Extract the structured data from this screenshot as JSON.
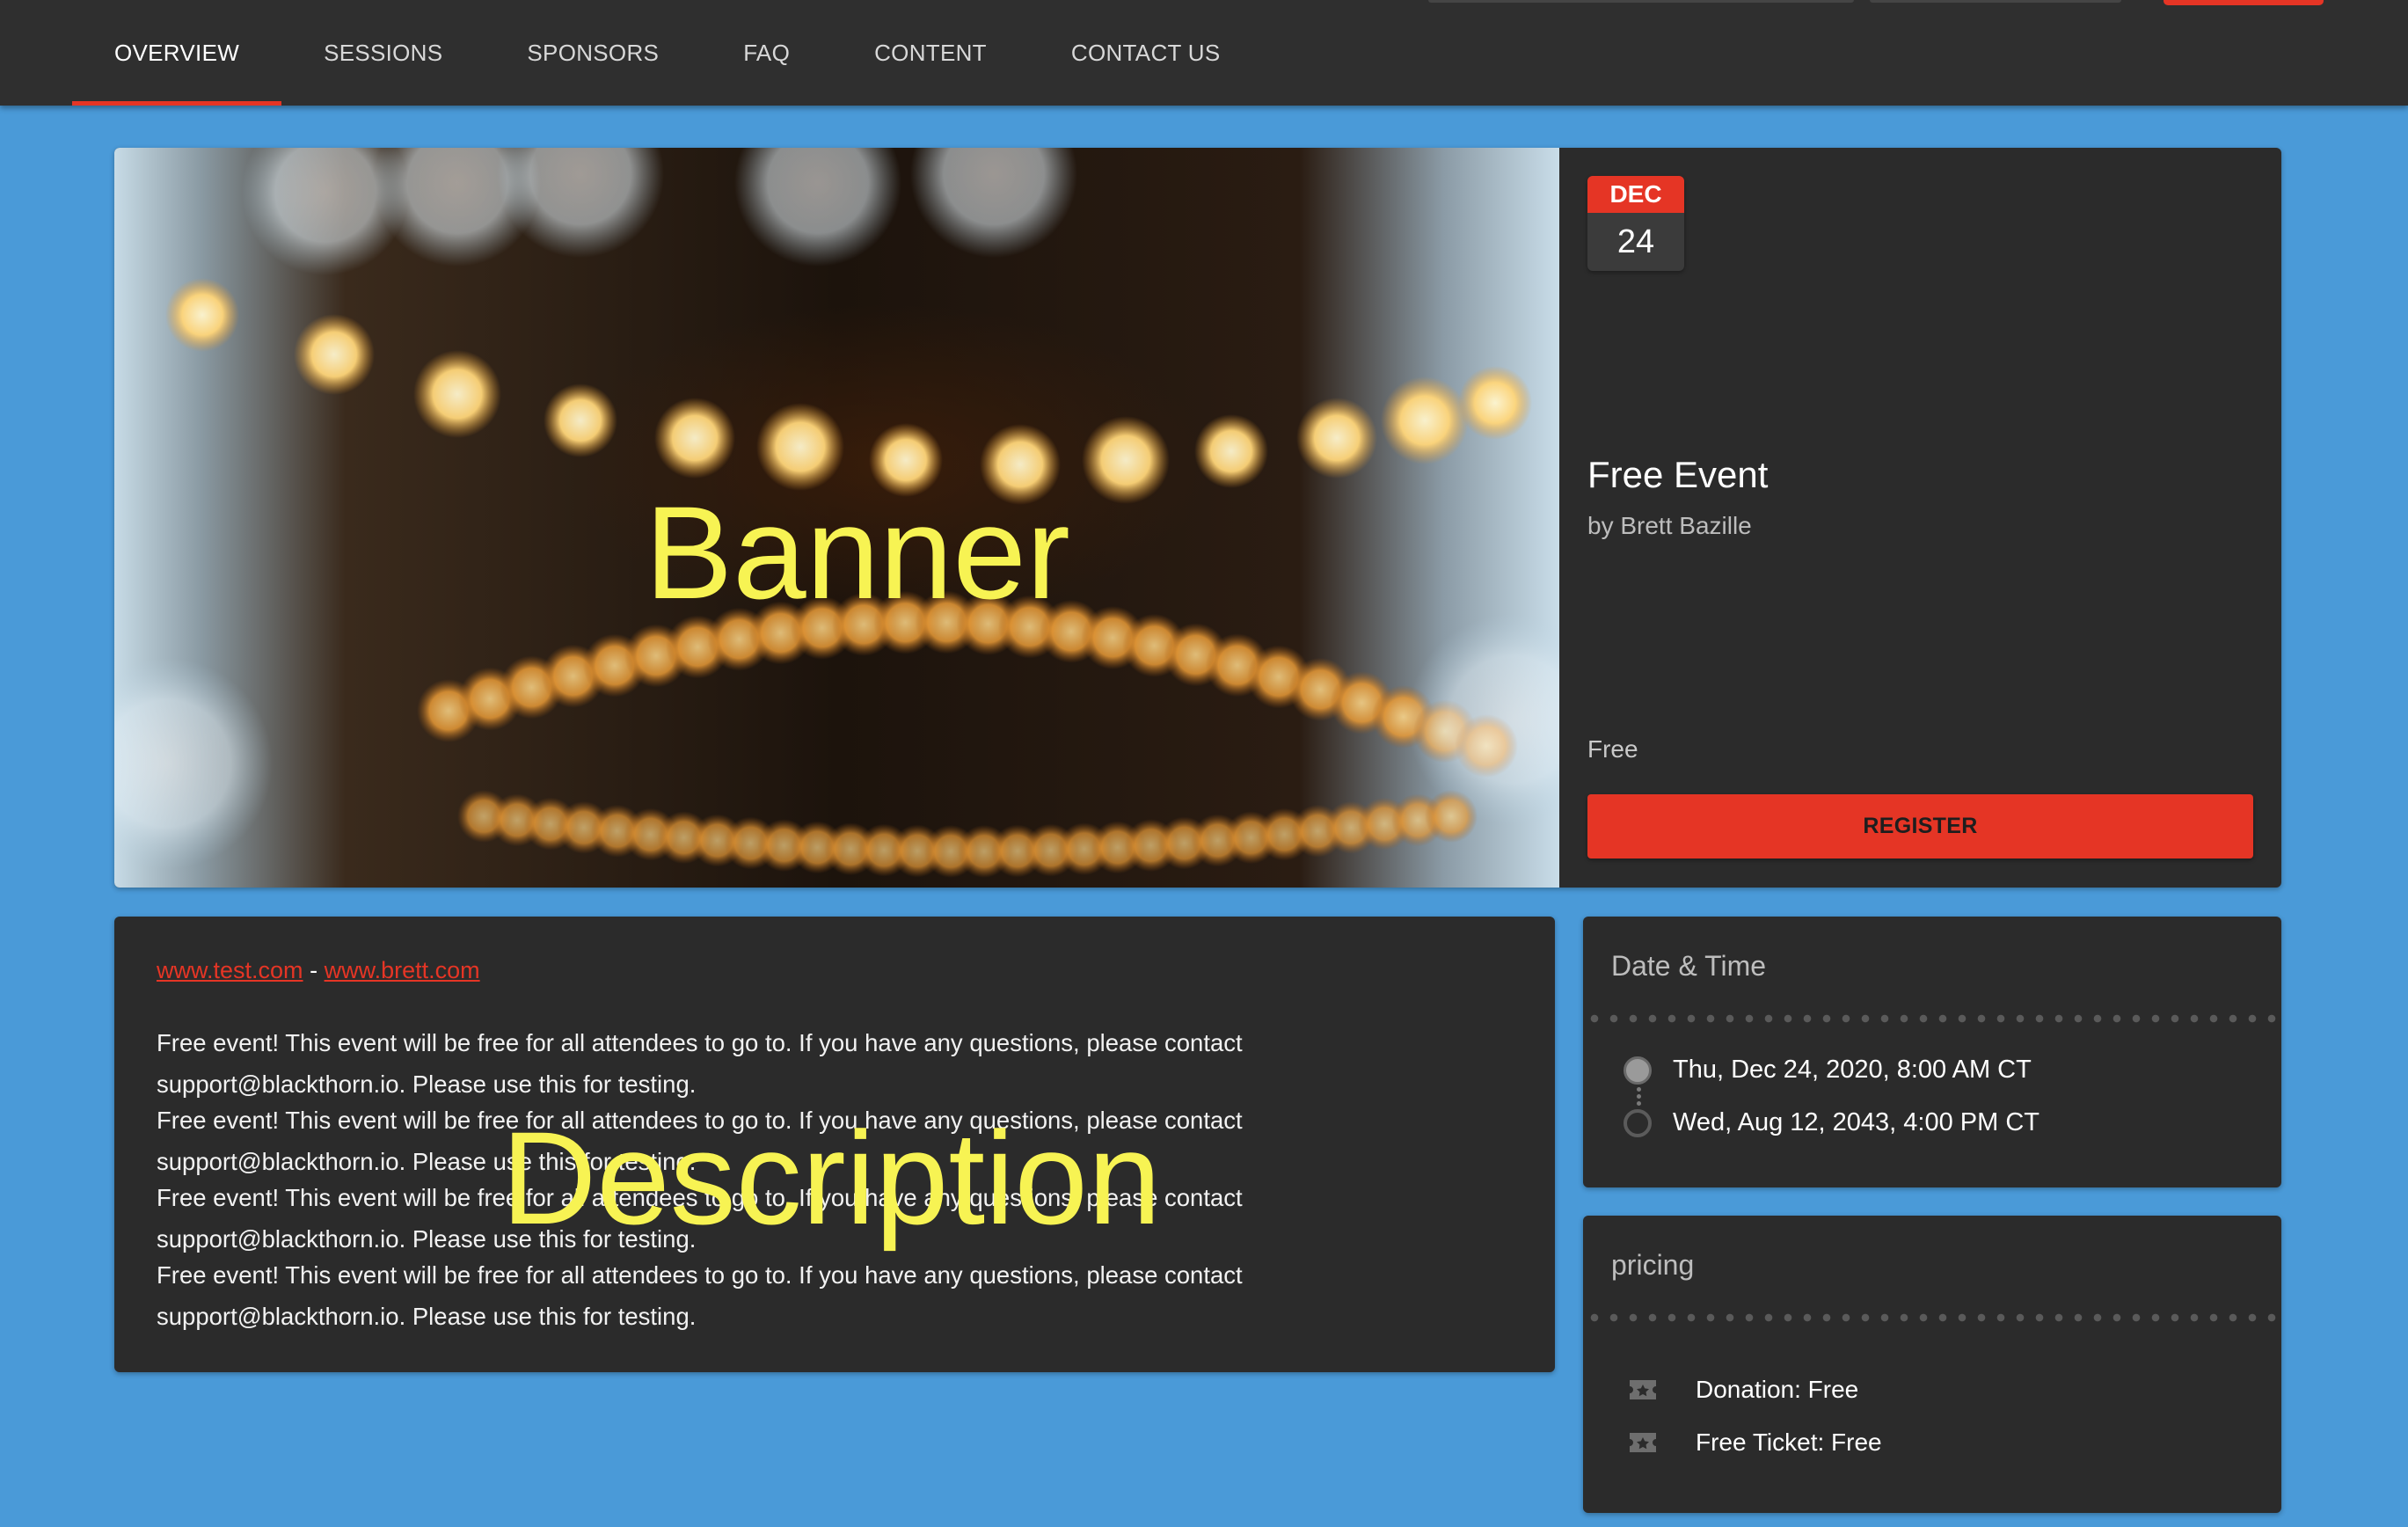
{
  "nav": {
    "tabs": [
      {
        "label": "OVERVIEW",
        "active": true
      },
      {
        "label": "SESSIONS",
        "active": false
      },
      {
        "label": "SPONSORS",
        "active": false
      },
      {
        "label": "FAQ",
        "active": false
      },
      {
        "label": "CONTENT",
        "active": false
      },
      {
        "label": "CONTACT US",
        "active": false
      }
    ]
  },
  "banner": {
    "overlay_label": "Banner"
  },
  "event": {
    "month": "DEC",
    "day": "24",
    "title": "Free Event",
    "organizer": "by Brett Bazille",
    "price": "Free",
    "register_label": "REGISTER"
  },
  "description": {
    "link1": "www.test.com",
    "separator": "-",
    "link2": "www.brett.com",
    "paragraphs": [
      "Free event! This event will be free for all attendees to go to. If you have any questions, please contact support@blackthorn.io. Please use this for testing.",
      "Free event! This event will be free for all attendees to go to. If you have any questions, please contact support@blackthorn.io. Please use this for testing.",
      "Free event! This event will be free for all attendees to go to. If you have any questions, please contact support@blackthorn.io. Please use this for testing.",
      "Free event! This event will be free for all attendees to go to. If you have any questions, please contact support@blackthorn.io. Please use this for testing."
    ],
    "overlay_label": "Description"
  },
  "datetime": {
    "title": "Date & Time",
    "start": "Thu, Dec 24, 2020, 8:00 AM CT",
    "end": "Wed, Aug 12, 2043, 4:00 PM CT"
  },
  "pricing": {
    "title": "pricing",
    "items": [
      {
        "label": "Donation: Free",
        "icon": "ticket-icon"
      },
      {
        "label": "Free Ticket: Free",
        "icon": "ticket-icon"
      }
    ]
  },
  "colors": {
    "page_background": "#4a9ad8",
    "card_background": "#2b2b2b",
    "nav_background": "#2f2f2f",
    "accent_red": "#e53525",
    "overlay_yellow": "#f7f353"
  }
}
